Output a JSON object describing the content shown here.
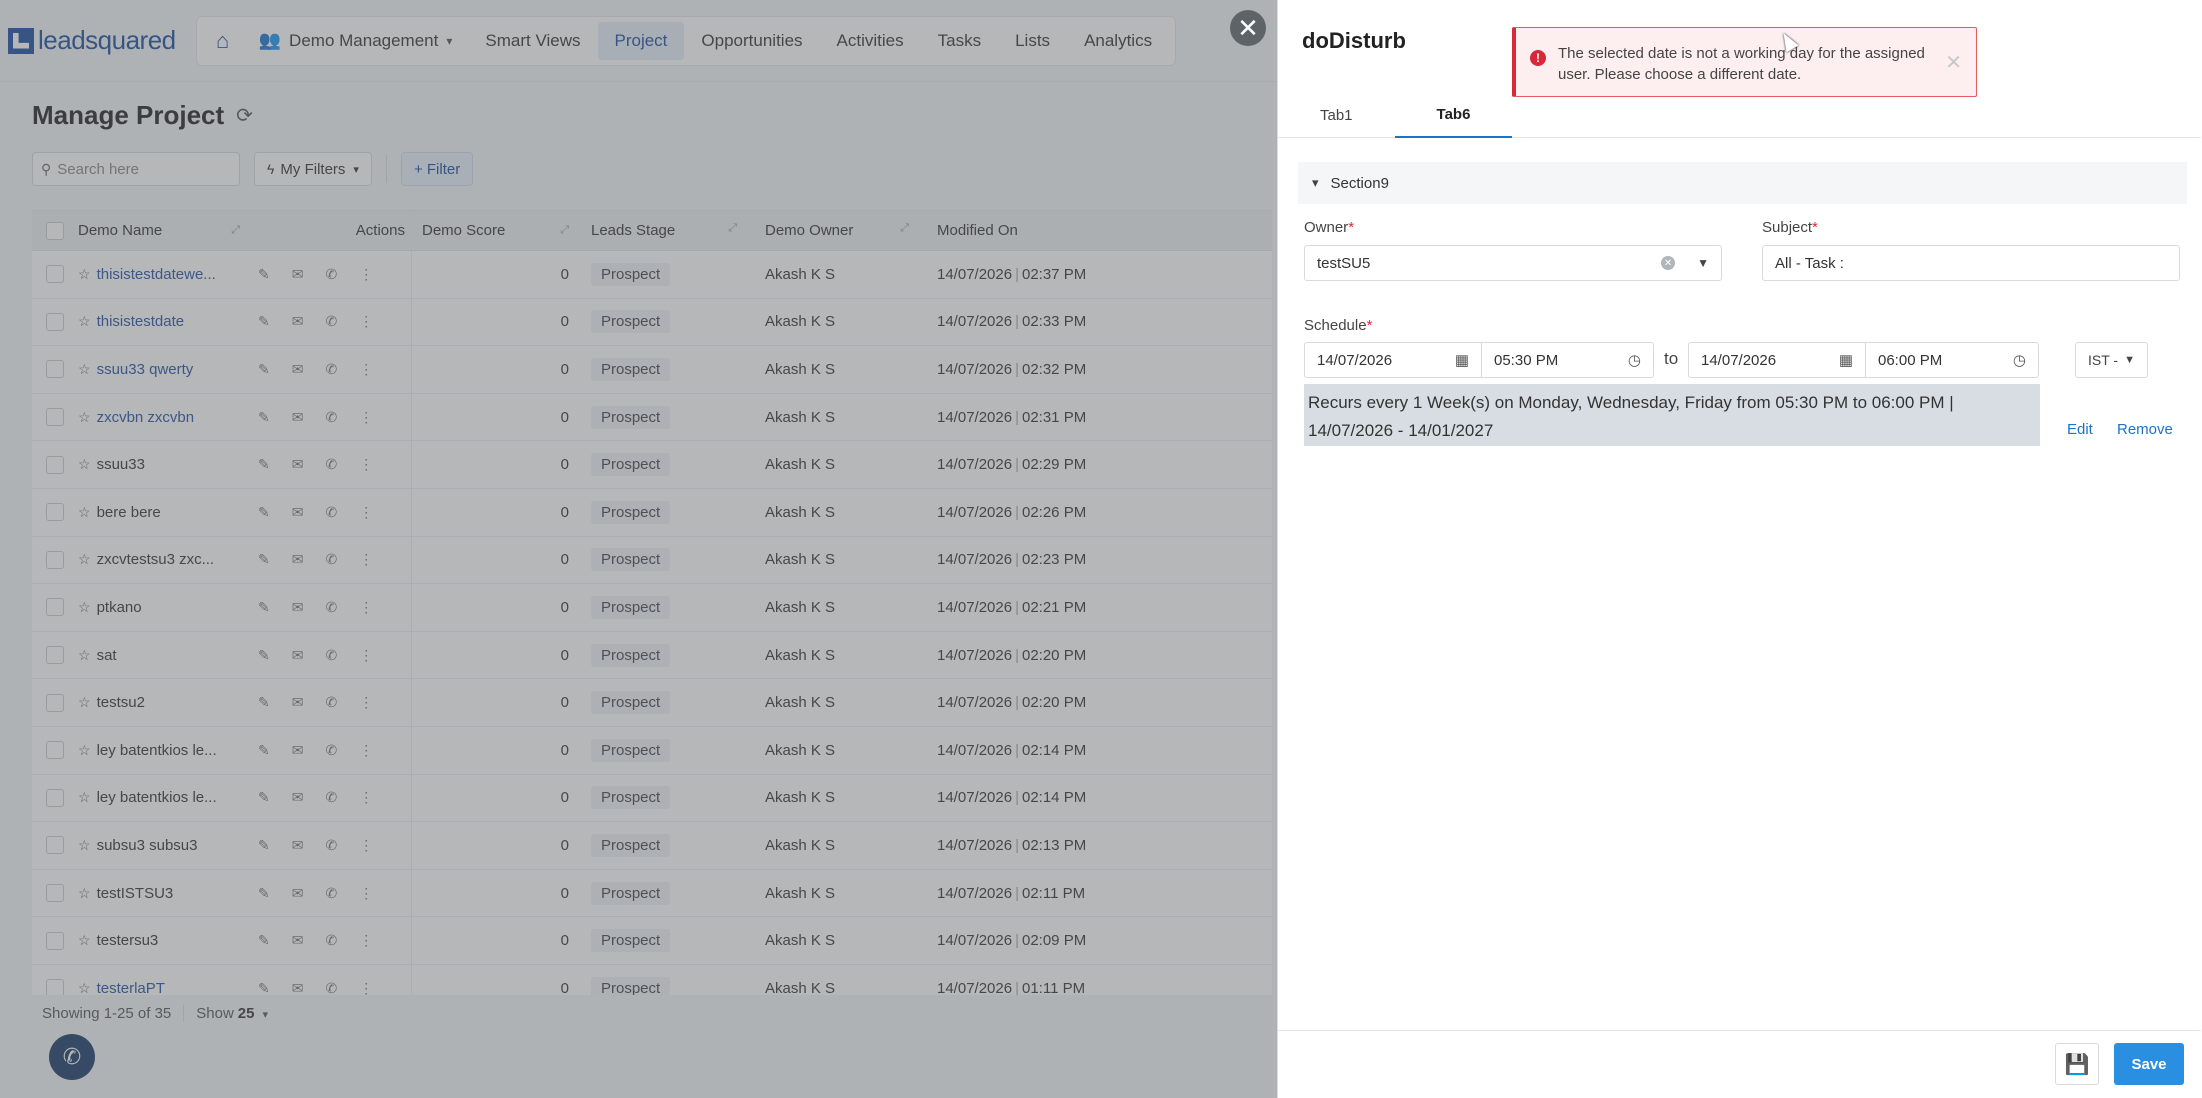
{
  "app": {
    "logo_text": "leadsquared",
    "nav": {
      "dropdown_label": "Demo Management",
      "items": [
        "Smart Views",
        "Project",
        "Opportunities",
        "Activities",
        "Tasks",
        "Lists",
        "Analytics"
      ],
      "active": "Project"
    },
    "page_title": "Manage Project",
    "search_placeholder": "Search here",
    "my_filters_label": "My Filters",
    "filter_label": "+ Filter",
    "columns": {
      "name": "Demo Name",
      "actions": "Actions",
      "score": "Demo Score",
      "stage": "Leads Stage",
      "owner": "Demo Owner",
      "modified": "Modified On"
    },
    "rows": [
      {
        "name": "thisistestdatewe...",
        "link": true,
        "score": "0",
        "stage": "Prospect",
        "owner": "Akash K S",
        "date": "14/07/2026",
        "time": "02:37 PM"
      },
      {
        "name": "thisistestdate",
        "link": true,
        "score": "0",
        "stage": "Prospect",
        "owner": "Akash K S",
        "date": "14/07/2026",
        "time": "02:33 PM"
      },
      {
        "name": "ssuu33 qwerty",
        "link": true,
        "score": "0",
        "stage": "Prospect",
        "owner": "Akash K S",
        "date": "14/07/2026",
        "time": "02:32 PM"
      },
      {
        "name": "zxcvbn zxcvbn",
        "link": true,
        "score": "0",
        "stage": "Prospect",
        "owner": "Akash K S",
        "date": "14/07/2026",
        "time": "02:31 PM"
      },
      {
        "name": "ssuu33",
        "link": false,
        "score": "0",
        "stage": "Prospect",
        "owner": "Akash K S",
        "date": "14/07/2026",
        "time": "02:29 PM"
      },
      {
        "name": "bere bere",
        "link": false,
        "score": "0",
        "stage": "Prospect",
        "owner": "Akash K S",
        "date": "14/07/2026",
        "time": "02:26 PM"
      },
      {
        "name": "zxcvtestsu3 zxc...",
        "link": false,
        "score": "0",
        "stage": "Prospect",
        "owner": "Akash K S",
        "date": "14/07/2026",
        "time": "02:23 PM"
      },
      {
        "name": "ptkano",
        "link": false,
        "score": "0",
        "stage": "Prospect",
        "owner": "Akash K S",
        "date": "14/07/2026",
        "time": "02:21 PM"
      },
      {
        "name": "sat",
        "link": false,
        "score": "0",
        "stage": "Prospect",
        "owner": "Akash K S",
        "date": "14/07/2026",
        "time": "02:20 PM"
      },
      {
        "name": "testsu2",
        "link": false,
        "score": "0",
        "stage": "Prospect",
        "owner": "Akash K S",
        "date": "14/07/2026",
        "time": "02:20 PM"
      },
      {
        "name": "ley batentkios le...",
        "link": false,
        "score": "0",
        "stage": "Prospect",
        "owner": "Akash K S",
        "date": "14/07/2026",
        "time": "02:14 PM"
      },
      {
        "name": "ley batentkios le...",
        "link": false,
        "score": "0",
        "stage": "Prospect",
        "owner": "Akash K S",
        "date": "14/07/2026",
        "time": "02:14 PM"
      },
      {
        "name": "subsu3 subsu3",
        "link": false,
        "score": "0",
        "stage": "Prospect",
        "owner": "Akash K S",
        "date": "14/07/2026",
        "time": "02:13 PM"
      },
      {
        "name": "testISTSU3",
        "link": false,
        "score": "0",
        "stage": "Prospect",
        "owner": "Akash K S",
        "date": "14/07/2026",
        "time": "02:11 PM"
      },
      {
        "name": "testersu3",
        "link": false,
        "score": "0",
        "stage": "Prospect",
        "owner": "Akash K S",
        "date": "14/07/2026",
        "time": "02:09 PM"
      },
      {
        "name": "testerlaPT",
        "link": true,
        "score": "0",
        "stage": "Prospect",
        "owner": "Akash K S",
        "date": "14/07/2026",
        "time": "01:11 PM"
      }
    ],
    "pager_text": "Showing 1-25 of 35",
    "show_label": "Show",
    "show_value": "25"
  },
  "drawer": {
    "title": "doDisturb",
    "toast_message": "The selected date is not a working day for the assigned user. Please choose a different date.",
    "tabs": [
      "Tab1",
      "Tab6"
    ],
    "active_tab": "Tab6",
    "section_title": "Section9",
    "owner_label": "Owner",
    "owner_value": "testSU5",
    "subject_label": "Subject",
    "subject_value": "All - Task :",
    "schedule_label": "Schedule",
    "start_date": "14/07/2026",
    "start_time": "05:30 PM",
    "to_label": "to",
    "end_date": "14/07/2026",
    "end_time": "06:00 PM",
    "timezone": "IST -",
    "recurrence_text": "Recurs every 1 Week(s) on Monday, Wednesday, Friday from 05:30 PM to 06:00 PM | 14/07/2026 - 14/01/2027",
    "edit_label": "Edit",
    "remove_label": "Remove",
    "save_label": "Save"
  },
  "colors": {
    "brand": "#1a4e9e",
    "link": "#1a73c9",
    "error": "#d9283a",
    "save": "#2a8fe0"
  }
}
